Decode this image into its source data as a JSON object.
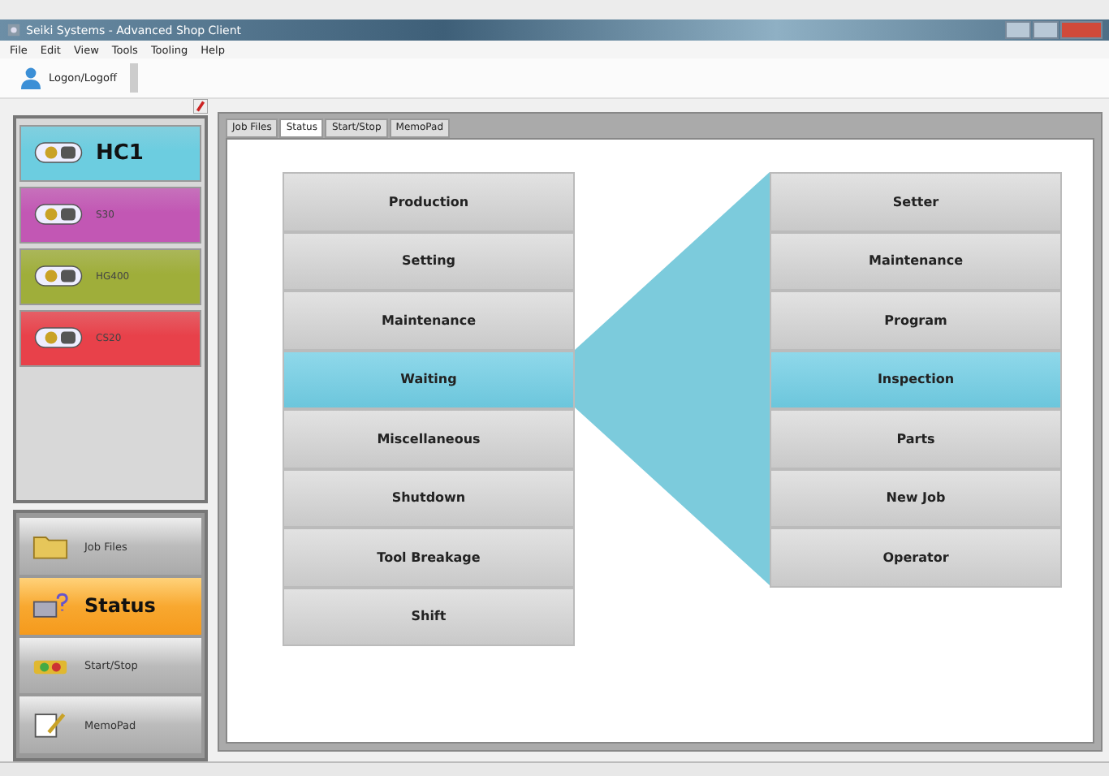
{
  "window": {
    "title": "Seiki Systems - Advanced Shop Client"
  },
  "menu": [
    "File",
    "Edit",
    "View",
    "Tools",
    "Tooling",
    "Help"
  ],
  "toolbar": {
    "button": "Logon/Logoff"
  },
  "machines": [
    {
      "name": "HC1",
      "selected": true,
      "color": "#6ccde0"
    },
    {
      "name": "S30",
      "selected": false,
      "color": "#c257b4"
    },
    {
      "name": "HG400",
      "selected": false,
      "color": "#9fae3a"
    },
    {
      "name": "CS20",
      "selected": false,
      "color": "#e8414a"
    }
  ],
  "nav": [
    {
      "label": "Job Files",
      "selected": false,
      "kind": "folder"
    },
    {
      "label": "Status",
      "selected": true,
      "kind": "status"
    },
    {
      "label": "Start/Stop",
      "selected": false,
      "kind": "lights"
    },
    {
      "label": "MemoPad",
      "selected": false,
      "kind": "memo"
    }
  ],
  "tabs": [
    {
      "label": "Job Files",
      "selected": false
    },
    {
      "label": "Status",
      "selected": true
    },
    {
      "label": "Start/Stop",
      "selected": false
    },
    {
      "label": "MemoPad",
      "selected": false
    }
  ],
  "status_list": [
    {
      "label": "Production",
      "selected": false
    },
    {
      "label": "Setting",
      "selected": false
    },
    {
      "label": "Maintenance",
      "selected": false
    },
    {
      "label": "Waiting",
      "selected": true
    },
    {
      "label": "Miscellaneous",
      "selected": false
    },
    {
      "label": "Shutdown",
      "selected": false
    },
    {
      "label": "Tool Breakage",
      "selected": false
    },
    {
      "label": "Shift",
      "selected": false
    }
  ],
  "reason_list": [
    {
      "label": "Setter",
      "selected": false
    },
    {
      "label": "Maintenance",
      "selected": false
    },
    {
      "label": "Program",
      "selected": false
    },
    {
      "label": "Inspection",
      "selected": true
    },
    {
      "label": "Parts",
      "selected": false
    },
    {
      "label": "New Job",
      "selected": false
    },
    {
      "label": "Operator",
      "selected": false
    }
  ]
}
